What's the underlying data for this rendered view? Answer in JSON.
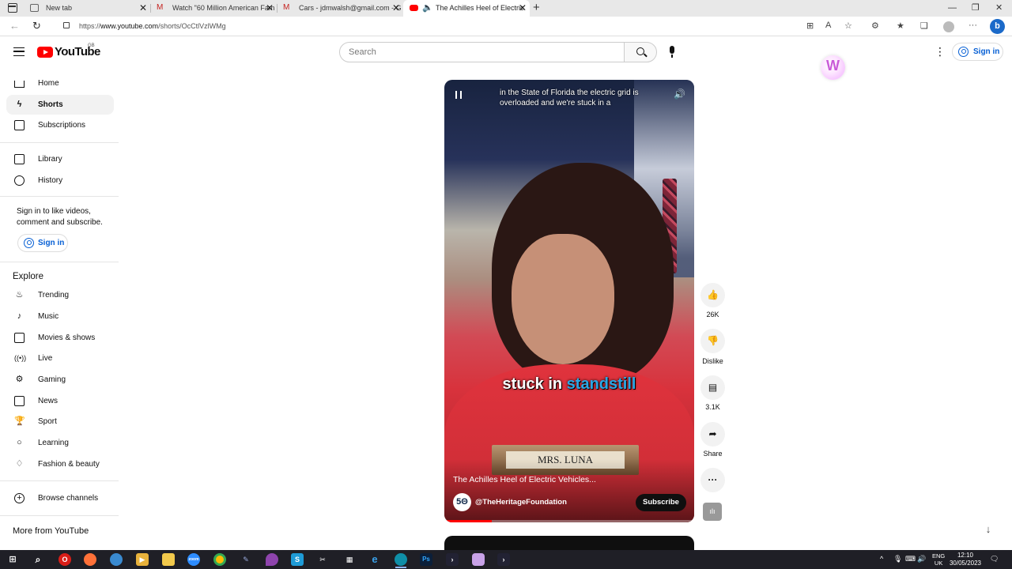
{
  "browser": {
    "tabs": [
      {
        "title": "New tab",
        "favicon": "page-icon"
      },
      {
        "title": "Watch \"60 Million American Fam",
        "favicon": "gmail-icon"
      },
      {
        "title": "Cars - jdmwalsh@gmail.com - G",
        "favicon": "gmail-icon"
      },
      {
        "title": "The Achilles Heel of Electric",
        "favicon": "youtube-icon",
        "active": true
      }
    ],
    "new_tab_symbol": "+",
    "url_prefix": "https://",
    "url_domain": "www.youtube.com",
    "url_path": "/shorts/OcCtlVzlWMg"
  },
  "header": {
    "logo_text": "YouTube",
    "region": "GB",
    "search_placeholder": "Search",
    "signin_label": "Sign in",
    "extension_letter": "W"
  },
  "sidebar": {
    "primary": [
      {
        "label": "Home",
        "icon": "home-icon"
      },
      {
        "label": "Shorts",
        "icon": "shorts-icon",
        "active": true
      },
      {
        "label": "Subscriptions",
        "icon": "subscriptions-icon"
      }
    ],
    "library": [
      {
        "label": "Library",
        "icon": "library-icon"
      },
      {
        "label": "History",
        "icon": "history-icon"
      }
    ],
    "signin_prompt": "Sign in to like videos, comment and subscribe.",
    "signin_label": "Sign in",
    "explore_heading": "Explore",
    "explore": [
      {
        "label": "Trending",
        "icon": "trending-icon"
      },
      {
        "label": "Music",
        "icon": "music-icon"
      },
      {
        "label": "Movies & shows",
        "icon": "movies-icon"
      },
      {
        "label": "Live",
        "icon": "live-icon"
      },
      {
        "label": "Gaming",
        "icon": "gaming-icon"
      },
      {
        "label": "News",
        "icon": "news-icon"
      },
      {
        "label": "Sport",
        "icon": "sport-icon"
      },
      {
        "label": "Learning",
        "icon": "learning-icon"
      },
      {
        "label": "Fashion & beauty",
        "icon": "fashion-icon"
      }
    ],
    "browse_channels": "Browse channels",
    "more_heading": "More from YouTube"
  },
  "video": {
    "top_caption": "in the State of Florida the electric grid is overloaded and we're stuck in a",
    "subtitle_plain": "stuck in",
    "subtitle_highlight": "standstill",
    "nameplate": "MRS. LUNA",
    "title": "The Achilles Heel of Electric Vehicles...",
    "channel_logo": "5Θ",
    "channel": "@TheHeritageFoundation",
    "subscribe_label": "Subscribe",
    "progress": 0.19
  },
  "actions": {
    "like_count": "26K",
    "dislike_label": "Dislike",
    "comment_count": "3.1K",
    "share_label": "Share"
  },
  "taskbar": {
    "lang_top": "ENG",
    "lang_bottom": "UK",
    "time": "12:10",
    "date": "30/05/2023"
  }
}
